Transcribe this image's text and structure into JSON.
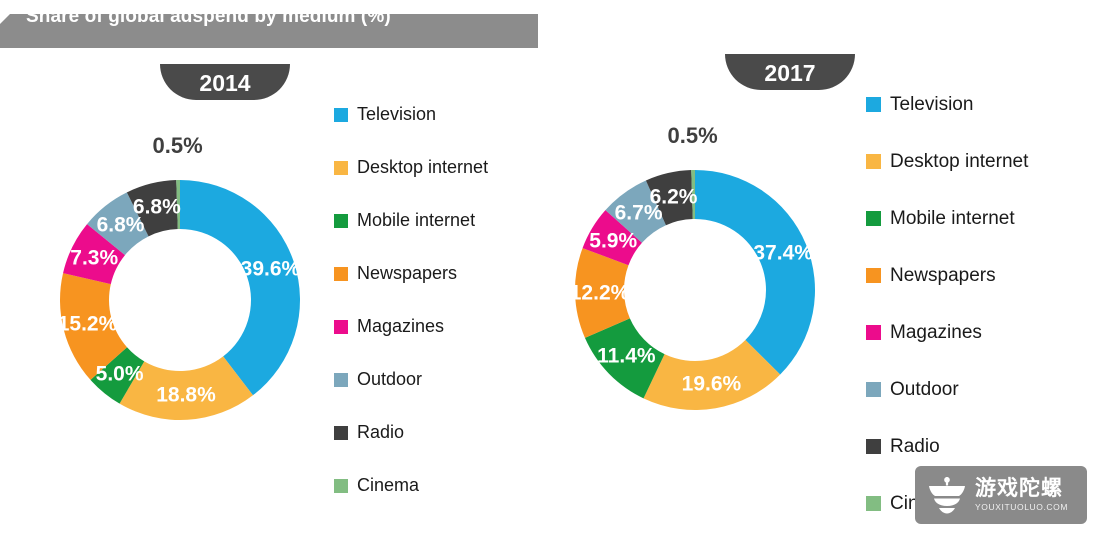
{
  "title": "Share of global adspend by medium (%)",
  "colors": {
    "television": "#1CA9E0",
    "desktop_internet": "#F9B643",
    "mobile_internet": "#149B3E",
    "newspapers": "#F79420",
    "magazines": "#EC0C8C",
    "outdoor": "#7CA7BC",
    "radio": "#3F3F3F",
    "cinema": "#82BD82",
    "banner": "#8C8C8C",
    "pill": "#4A4A4A",
    "label_dark": "#3F3F3F",
    "label_light": "#FFFFFF"
  },
  "panels": [
    {
      "year": "2014",
      "legend": [
        {
          "label": "Television",
          "color": "#1CA9E0"
        },
        {
          "label": "Desktop internet",
          "color": "#F9B643"
        },
        {
          "label": "Mobile internet",
          "color": "#149B3E"
        },
        {
          "label": "Newspapers",
          "color": "#F79420"
        },
        {
          "label": "Magazines",
          "color": "#EC0C8C"
        },
        {
          "label": "Outdoor",
          "color": "#7CA7BC"
        },
        {
          "label": "Radio",
          "color": "#3F3F3F"
        },
        {
          "label": "Cinema",
          "color": "#82BD82"
        }
      ]
    },
    {
      "year": "2017",
      "legend": [
        {
          "label": "Television",
          "color": "#1CA9E0"
        },
        {
          "label": "Desktop internet",
          "color": "#F9B643"
        },
        {
          "label": "Mobile internet",
          "color": "#149B3E"
        },
        {
          "label": "Newspapers",
          "color": "#F79420"
        },
        {
          "label": "Magazines",
          "color": "#EC0C8C"
        },
        {
          "label": "Outdoor",
          "color": "#7CA7BC"
        },
        {
          "label": "Radio",
          "color": "#3F3F3F"
        },
        {
          "label": "Cinema",
          "color": "#82BD82"
        }
      ]
    }
  ],
  "watermark": {
    "cn": "游戏陀螺",
    "en": "YOUXITUOLUO.COM"
  },
  "chart_data": [
    {
      "type": "pie",
      "variant": "donut",
      "title": "2014",
      "labels": [
        "Television",
        "Desktop internet",
        "Mobile internet",
        "Newspapers",
        "Magazines",
        "Outdoor",
        "Radio",
        "Cinema"
      ],
      "values": [
        39.6,
        18.8,
        5.0,
        15.2,
        7.3,
        6.8,
        6.8,
        0.5
      ],
      "value_labels": [
        "39.6%",
        "18.8%",
        "5.0%",
        "15.2%",
        "7.3%",
        "6.8%",
        "6.8%",
        "0.5%"
      ],
      "colors": [
        "#1CA9E0",
        "#F9B643",
        "#149B3E",
        "#F79420",
        "#EC0C8C",
        "#7CA7BC",
        "#3F3F3F",
        "#82BD82"
      ],
      "unit": "percent",
      "start_angle": 0,
      "direction": "clockwise",
      "legend_position": "right",
      "label_placement": [
        "inside",
        "inside",
        "inside",
        "inside",
        "inside",
        "inside",
        "inside",
        "outside"
      ]
    },
    {
      "type": "pie",
      "variant": "donut",
      "title": "2017",
      "labels": [
        "Television",
        "Desktop internet",
        "Mobile internet",
        "Newspapers",
        "Magazines",
        "Outdoor",
        "Radio",
        "Cinema"
      ],
      "values": [
        37.4,
        19.6,
        11.4,
        12.2,
        5.9,
        6.7,
        6.2,
        0.5
      ],
      "value_labels": [
        "37.4%",
        "19.6%",
        "11.4%",
        "12.2%",
        "5.9%",
        "6.7%",
        "6.2%",
        "0.5%"
      ],
      "colors": [
        "#1CA9E0",
        "#F9B643",
        "#149B3E",
        "#F79420",
        "#EC0C8C",
        "#7CA7BC",
        "#3F3F3F",
        "#82BD82"
      ],
      "unit": "percent",
      "start_angle": 0,
      "direction": "clockwise",
      "legend_position": "right",
      "label_placement": [
        "inside",
        "inside",
        "inside",
        "inside",
        "inside",
        "inside",
        "inside",
        "outside"
      ]
    }
  ]
}
